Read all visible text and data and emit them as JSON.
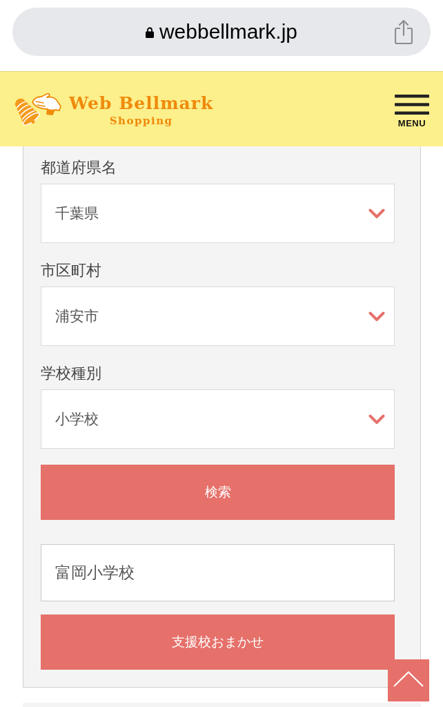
{
  "browser": {
    "url": "webbellmark.jp"
  },
  "header": {
    "brand_title": "Web Bellmark",
    "brand_subtitle": "Shopping",
    "menu_label": "MENU"
  },
  "form": {
    "selects": [
      {
        "label": "都道府県名",
        "value": "千葉県"
      },
      {
        "label": "市区町村",
        "value": "浦安市"
      },
      {
        "label": "学校種別",
        "value": "小学校"
      }
    ],
    "search_button": "検索",
    "school_field": {
      "value": "富岡小学校"
    },
    "auto_button": "支援校おまかせ"
  }
}
